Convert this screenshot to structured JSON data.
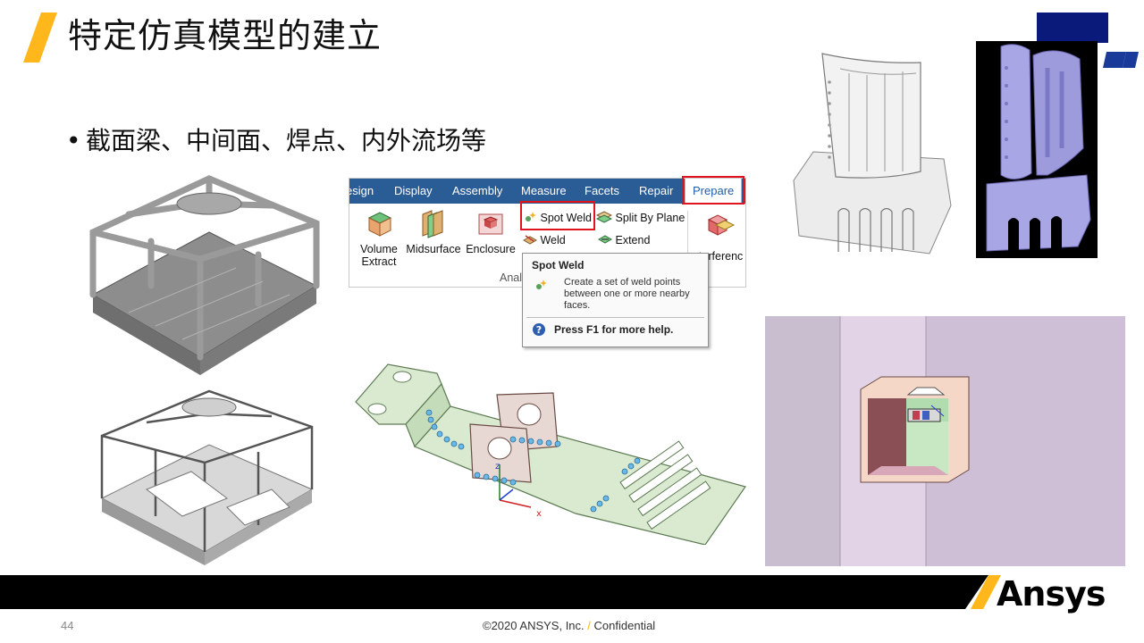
{
  "slide": {
    "title": "特定仿真模型的建立",
    "bullet": "截面梁、中间面、焊点、内外流场等",
    "page_number": "44",
    "footer_copyright": "©2020 ANSYS, Inc.",
    "footer_slash": "/",
    "footer_confidential": "Confidential",
    "brand": "Ansys",
    "accent_color": "#FFB71B"
  },
  "ribbon": {
    "tabs": [
      "esign",
      "Display",
      "Assembly",
      "Measure",
      "Facets",
      "Repair",
      "Prepare"
    ],
    "active_tab": "Prepare",
    "large_buttons": [
      {
        "label": "Volume\nExtract",
        "icon": "volume-extract-icon"
      },
      {
        "label": "Midsurface",
        "icon": "midsurface-icon"
      },
      {
        "label": "Enclosure",
        "icon": "enclosure-icon"
      },
      {
        "label": "nterferenc",
        "icon": "interference-icon"
      }
    ],
    "small_commands": {
      "spot_weld": "Spot Weld",
      "split_by_plane": "Split By Plane",
      "weld": "Weld",
      "extend": "Extend"
    },
    "group_label_partial": "Anal"
  },
  "tooltip": {
    "title": "Spot Weld",
    "description": "Create a set of weld points between one or more nearby faces.",
    "help": "Press F1 for more help."
  },
  "viewport": {
    "axis_z": "z",
    "axis_x": "x"
  }
}
